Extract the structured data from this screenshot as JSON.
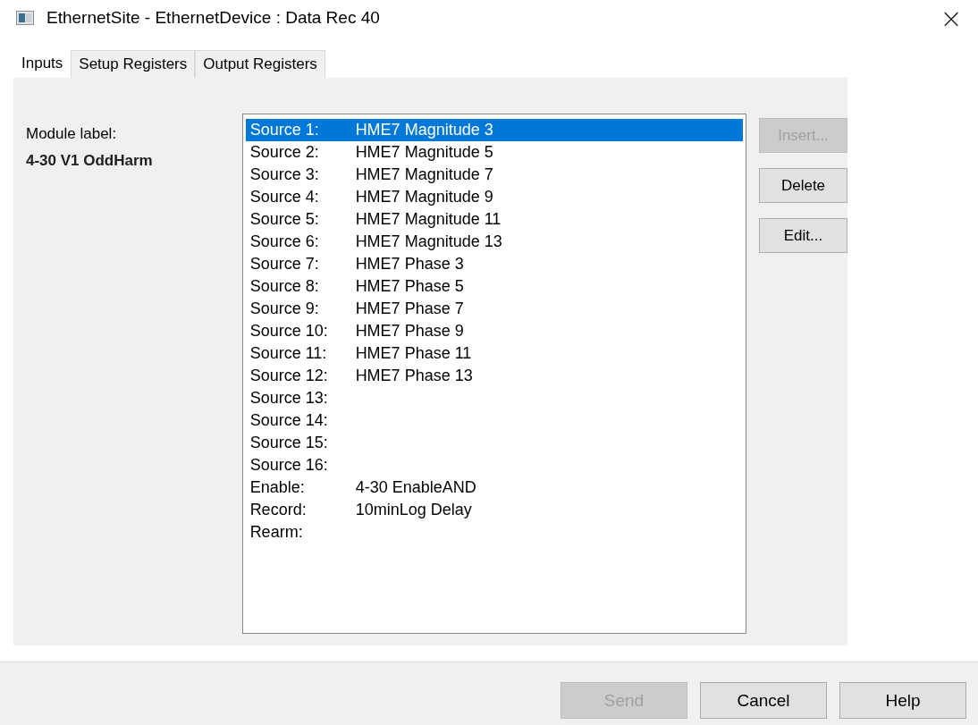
{
  "window": {
    "title": "EthernetSite - EthernetDevice : Data Rec 40",
    "close": "×"
  },
  "tabs": [
    {
      "label": "Inputs",
      "selected": true
    },
    {
      "label": "Setup Registers",
      "selected": false
    },
    {
      "label": "Output Registers",
      "selected": false
    }
  ],
  "module": {
    "label": "Module label:",
    "value": "4-30 V1 OddHarm"
  },
  "inputs": [
    {
      "name": "Source 1:",
      "value": "HME7 Magnitude 3",
      "selected": true
    },
    {
      "name": "Source 2:",
      "value": "HME7 Magnitude 5",
      "selected": false
    },
    {
      "name": "Source 3:",
      "value": "HME7 Magnitude 7",
      "selected": false
    },
    {
      "name": "Source 4:",
      "value": "HME7 Magnitude 9",
      "selected": false
    },
    {
      "name": "Source 5:",
      "value": "HME7 Magnitude 11",
      "selected": false
    },
    {
      "name": "Source 6:",
      "value": "HME7 Magnitude 13",
      "selected": false
    },
    {
      "name": "Source 7:",
      "value": "HME7 Phase 3",
      "selected": false
    },
    {
      "name": "Source 8:",
      "value": "HME7 Phase 5",
      "selected": false
    },
    {
      "name": "Source 9:",
      "value": "HME7 Phase 7",
      "selected": false
    },
    {
      "name": "Source 10:",
      "value": "HME7 Phase 9",
      "selected": false
    },
    {
      "name": "Source 11:",
      "value": "HME7 Phase 11",
      "selected": false
    },
    {
      "name": "Source 12:",
      "value": "HME7 Phase 13",
      "selected": false
    },
    {
      "name": "Source 13:",
      "selected": false
    },
    {
      "name": "Source 14:",
      "selected": false
    },
    {
      "name": "Source 15:",
      "selected": false
    },
    {
      "name": "Source 16:",
      "selected": false
    },
    {
      "name": "Enable:",
      "value": "4-30 EnableAND",
      "selected": false
    },
    {
      "name": "Record:",
      "value": "10minLog Delay",
      "selected": false
    },
    {
      "name": "Rearm:",
      "selected": false
    }
  ],
  "side_buttons": [
    {
      "label": "Insert...",
      "disabled": true
    },
    {
      "label": "Delete",
      "disabled": false
    },
    {
      "label": "Edit...",
      "disabled": false
    }
  ],
  "footer_buttons": [
    {
      "label": "Send",
      "disabled": true
    },
    {
      "label": "Cancel",
      "disabled": false
    },
    {
      "label": "Help",
      "disabled": false
    }
  ]
}
